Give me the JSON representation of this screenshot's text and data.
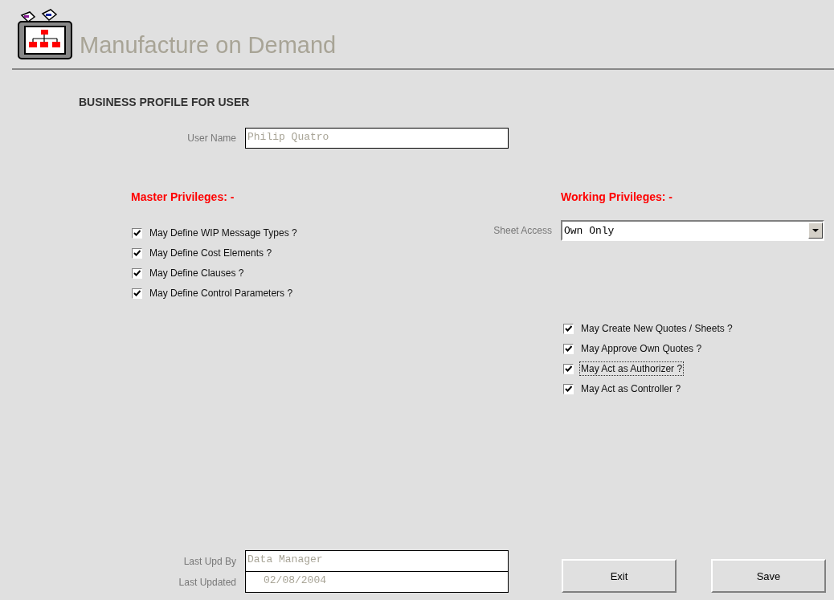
{
  "app_title": "Manufacture on Demand",
  "page_heading": "BUSINESS PROFILE FOR USER",
  "user_name": {
    "label": "User Name",
    "value": "Philip Quatro"
  },
  "master_privileges": {
    "heading": "Master Privileges: -",
    "items": [
      {
        "label": "May Define WIP Message Types ?",
        "checked": true,
        "focused": false
      },
      {
        "label": "May Define Cost Elements ?",
        "checked": true,
        "focused": false
      },
      {
        "label": "May Define Clauses ?",
        "checked": true,
        "focused": false
      },
      {
        "label": "May Define Control Parameters ?",
        "checked": true,
        "focused": false
      }
    ]
  },
  "working_privileges": {
    "heading": "Working Privileges: -",
    "sheet_access": {
      "label": "Sheet Access",
      "value": "Own Only"
    },
    "items": [
      {
        "label": "May Create New Quotes / Sheets ?",
        "checked": true,
        "focused": false
      },
      {
        "label": "May Approve Own Quotes ?",
        "checked": true,
        "focused": false
      },
      {
        "label": "May Act as Authorizer ?",
        "checked": true,
        "focused": true
      },
      {
        "label": "May Act as Controller ?",
        "checked": true,
        "focused": false
      }
    ]
  },
  "last_upd_by": {
    "label": "Last Upd By",
    "value": "Data Manager"
  },
  "last_updated": {
    "label": "Last Updated",
    "value": "02/08/2004"
  },
  "buttons": [
    "Exit",
    "Save"
  ]
}
